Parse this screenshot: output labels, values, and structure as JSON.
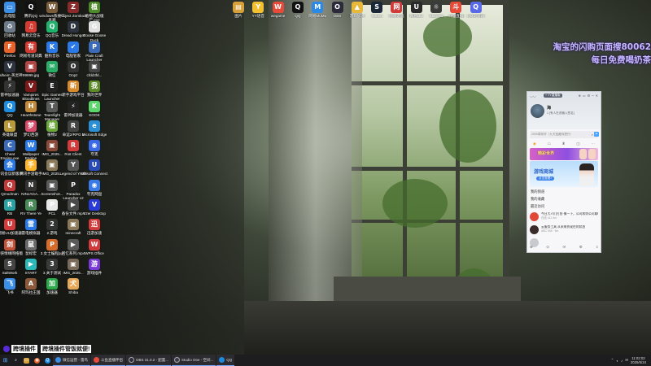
{
  "desktop_icons": [
    {
      "label": "此电脑",
      "glyph": "▭",
      "color": "#3a8ee6"
    },
    {
      "label": "腾讯QQ",
      "glyph": "Q",
      "color": "#111111"
    },
    {
      "label": "windows系统工具箱",
      "glyph": "W",
      "color": "#7b5c3a"
    },
    {
      "label": "Project Zomboid",
      "glyph": "Z",
      "color": "#8a2a2a"
    },
    {
      "label": "植物大战僵尸.exe",
      "glyph": "植",
      "color": "#4d8a2a"
    },
    {
      "label": "回收站",
      "glyph": "♻",
      "color": "#6c7a89"
    },
    {
      "label": "网易云音乐",
      "glyph": "♫",
      "color": "#d33a31"
    },
    {
      "label": "QQ音乐",
      "glyph": "Q",
      "color": "#1fb26b"
    },
    {
      "label": "Dread Hunger",
      "glyph": "D",
      "color": "#2d3440"
    },
    {
      "label": "Goose Goose Duck",
      "glyph": "G",
      "color": "#e0e0e0"
    },
    {
      "label": "Firefox",
      "glyph": "F",
      "color": "#e8632b"
    },
    {
      "label": "网易有道词典",
      "glyph": "有",
      "color": "#d33a31"
    },
    {
      "label": "酷狗音乐",
      "glyph": "K",
      "color": "#2a79e6"
    },
    {
      "label": "电脑管家",
      "glyph": "✔",
      "color": "#2a79e6"
    },
    {
      "label": "Plain Craft Launcher",
      "glyph": "P",
      "color": "#3a6ab8"
    },
    {
      "label": "Valheim 英灵神殿",
      "glyph": "V",
      "color": "#2d3440"
    },
    {
      "label": "99999.jpg",
      "glyph": "▣",
      "color": "#b04545"
    },
    {
      "label": "微信",
      "glyph": "✉",
      "color": "#2aae67"
    },
    {
      "label": "Oopz",
      "glyph": "O",
      "color": "#333333"
    },
    {
      "label": "cfdd3fd...",
      "glyph": "▣",
      "color": "#444444"
    },
    {
      "label": "雷神加速器",
      "glyph": "⚡",
      "color": "#333333"
    },
    {
      "label": "Vampires Bloodlines",
      "glyph": "V",
      "color": "#7a1a1a"
    },
    {
      "label": "Epic Games Launcher",
      "glyph": "E",
      "color": "#222222"
    },
    {
      "label": "新手游戏平台",
      "glyph": "新",
      "color": "#d68a2a"
    },
    {
      "label": "我的世界",
      "glyph": "我",
      "color": "#5b8a2a"
    },
    {
      "label": "QQ",
      "glyph": "Q",
      "color": "#1d8ce0"
    },
    {
      "label": "Hearthstone",
      "glyph": "H",
      "color": "#c08a3a"
    },
    {
      "label": "Teamfight Manager",
      "glyph": "T",
      "color": "#5a5a5a"
    },
    {
      "label": "雷神加速器",
      "glyph": "⚡",
      "color": "#222222"
    },
    {
      "label": "KOOK",
      "glyph": "K",
      "color": "#5ad66b"
    },
    {
      "label": "英雄联盟",
      "glyph": "L",
      "color": "#b89a3a"
    },
    {
      "label": "梦幻西游",
      "glyph": "梦",
      "color": "#d84a6a"
    },
    {
      "label": "植物2",
      "glyph": "植",
      "color": "#6aa83a"
    },
    {
      "label": "命运2/RPG 2",
      "glyph": "R",
      "color": "#444444"
    },
    {
      "label": "Microsoft Edge",
      "glyph": "e",
      "color": "#2b8fd6"
    },
    {
      "label": "Cheat Engine.exe",
      "glyph": "C",
      "color": "#3a6ab8"
    },
    {
      "label": "Wallpaper Engine",
      "glyph": "W",
      "color": "#2a79e6"
    },
    {
      "label": "IMG_2025...",
      "glyph": "▣",
      "color": "#8a4a3a"
    },
    {
      "label": "Riot Client",
      "glyph": "R",
      "color": "#d13b3b"
    },
    {
      "label": "夸克",
      "glyph": "◉",
      "color": "#3a6ae6"
    },
    {
      "label": "腾讯会议新版本",
      "glyph": "会",
      "color": "#2a79e6"
    },
    {
      "label": "腾讯手游助手",
      "glyph": "手",
      "color": "#ffb52a"
    },
    {
      "label": "IMG_2025...",
      "glyph": "▣",
      "color": "#8a7a5a"
    },
    {
      "label": "Legend of YMIR",
      "glyph": "Y",
      "color": "#555555"
    },
    {
      "label": "Ubisoft Connect",
      "glyph": "U",
      "color": "#2a4ab8"
    },
    {
      "label": "Qmodman",
      "glyph": "Q",
      "color": "#c03a3a"
    },
    {
      "label": "NINJAGA...",
      "glyph": "N",
      "color": "#333333"
    },
    {
      "label": "Screenshot...",
      "glyph": "▣",
      "color": "#5a5a5a"
    },
    {
      "label": "Paradox Launcher v2",
      "glyph": "P",
      "color": "#222222"
    },
    {
      "label": "夸克网盘",
      "glyph": "◉",
      "color": "#3a7ae6"
    },
    {
      "label": "RB",
      "glyph": "R",
      "color": "#2aa0a0"
    },
    {
      "label": "RV There Ye",
      "glyph": "R",
      "color": "#4a8a5a"
    },
    {
      "label": "PCL",
      "glyph": "P",
      "color": "#e8e8e8"
    },
    {
      "label": "备份文件.mp4",
      "glyph": "▶",
      "color": "#4a4a4a"
    },
    {
      "label": "V2er Desktop",
      "glyph": "V",
      "color": "#2a3ad6"
    },
    {
      "label": "网易UU加速器",
      "glyph": "U",
      "color": "#d13b3b"
    },
    {
      "label": "雷电模拟器",
      "glyph": "雷",
      "color": "#2a79e6"
    },
    {
      "label": "2.游戏",
      "glyph": "2",
      "color": "#333333"
    },
    {
      "label": "minecraft",
      "glyph": "▣",
      "color": "#8a7a5a"
    },
    {
      "label": "迅游加速",
      "glyph": "迅",
      "color": "#d13b3b"
    },
    {
      "label": "剑侠情缘网络版",
      "glyph": "剑",
      "color": "#c0523a"
    },
    {
      "label": "鼠标宏",
      "glyph": "鼠",
      "color": "#6a6a6a"
    },
    {
      "label": "3.女士编程ppt",
      "glyph": "P",
      "color": "#d86a2a"
    },
    {
      "label": "回忆系列.mp4",
      "glyph": "▶",
      "color": "#5a5a5a"
    },
    {
      "label": "WPS Office",
      "glyph": "W",
      "color": "#d13b3b"
    },
    {
      "label": "SaltWork",
      "glyph": "S",
      "color": "#444444"
    },
    {
      "label": "START",
      "glyph": "▶",
      "color": "#2ab8b8"
    },
    {
      "label": "3.关于测试",
      "glyph": "3",
      "color": "#3a3a3a"
    },
    {
      "label": "IMG_2025...",
      "glyph": "▣",
      "color": "#7a6a5a"
    },
    {
      "label": "游戏插件",
      "glyph": "游",
      "color": "#7a3ad6"
    },
    {
      "label": "飞书",
      "glyph": "飞",
      "color": "#3a8ee6"
    },
    {
      "label": "阿玛拉王国",
      "glyph": "A",
      "color": "#8a5a3a"
    },
    {
      "label": "加速器",
      "glyph": "加",
      "color": "#2aa84a"
    },
    {
      "label": "Shiba",
      "glyph": "犬",
      "color": "#e8a85a"
    }
  ],
  "top_icons": [
    {
      "label": "图片",
      "glyph": "▤",
      "color": "#d6a03a"
    },
    {
      "label": "YY语音",
      "glyph": "Y",
      "color": "#f2c030"
    },
    {
      "label": "wegame",
      "glyph": "W",
      "color": "#e84a3a"
    },
    {
      "label": "QQ",
      "glyph": "Q",
      "color": "#111111"
    },
    {
      "label": "网易MuMu",
      "glyph": "M",
      "color": "#2a8ae6"
    },
    {
      "label": "OBS",
      "glyph": "O",
      "color": "#2a2a3a"
    },
    {
      "label": "游戏加速",
      "glyph": "▲",
      "color": "#e8b83a"
    },
    {
      "label": "Steam",
      "glyph": "S",
      "color": "#1b2838"
    },
    {
      "label": "网易游戏",
      "glyph": "网",
      "color": "#d13b3b"
    },
    {
      "label": "网易UU",
      "glyph": "U",
      "color": "#2a2a2a"
    },
    {
      "label": "Stardew",
      "glyph": "☼",
      "color": "#3a3a3a"
    },
    {
      "label": "斗鱼直播",
      "glyph": "斗",
      "color": "#e84a3a"
    },
    {
      "label": "QQ浏览器",
      "glyph": "Q",
      "color": "#5a6ae6"
    }
  ],
  "promo": {
    "line1": "淘宝的闪购页面搜80062",
    "line2": "每日免费喝奶茶"
  },
  "qq_panel": {
    "logo": "◡◡",
    "vip": "+ YY直播版",
    "controls": [
      "⊕",
      "▭",
      "⚙",
      "─",
      "✕"
    ],
    "name": "海",
    "signature": "1 [有人在说输入签名]",
    "search_placeholder": "2000周年好（九天宝藏待提升）",
    "tabs": [
      "◉",
      "☖",
      "♜",
      "◫",
      "⋯"
    ],
    "banner_text": "精彩世界",
    "ad_title": "游戏商城",
    "ad_button": "点击查看>",
    "menu": [
      "我的频道",
      "我的收藏",
      "最近访问"
    ],
    "items": [
      {
        "title": "今日大人们打扮 像一下，公司和你公司聊聊",
        "sub": "在线 412.4m",
        "color": "#e0483a"
      },
      {
        "title": "云服务工具 从未来到现在的状态",
        "sub": "ABC 948 · 5m",
        "color": "#3a2a2a"
      },
      {
        "title": "",
        "sub": "",
        "color": "#c9c9d0"
      }
    ],
    "bottom_icons": [
      "⊕",
      "⊙",
      "✉",
      "⚙",
      "≡"
    ]
  },
  "overlay_tip": {
    "text1": "跨境插件",
    "text2": "跨境插件管饭就便!"
  },
  "taskbar": {
    "start": "⊞",
    "search": "⌕",
    "pinned": [
      {
        "glyph": "▭",
        "color": "#d6a03a"
      },
      {
        "glyph": "◉",
        "color": "#e8632b"
      },
      {
        "glyph": "Q",
        "color": "#1d8ce0"
      }
    ],
    "tasks": [
      {
        "label": "微信运营 - 雷鸟",
        "color": "#3a8ee6"
      },
      {
        "label": "斗鱼直播伴侣",
        "color": "#e84a3a"
      },
      {
        "label": "OBS 31.0.2 - 配置...",
        "color": "#2a2a3a"
      },
      {
        "label": "Studio One - 空间...",
        "color": "#3a3a4a"
      },
      {
        "label": "QQ",
        "color": "#1d8ce0"
      }
    ],
    "tray_icons": [
      "⌃",
      "◐",
      "♪",
      "✉"
    ],
    "time": "11:02:02",
    "date": "2025/5/24"
  }
}
